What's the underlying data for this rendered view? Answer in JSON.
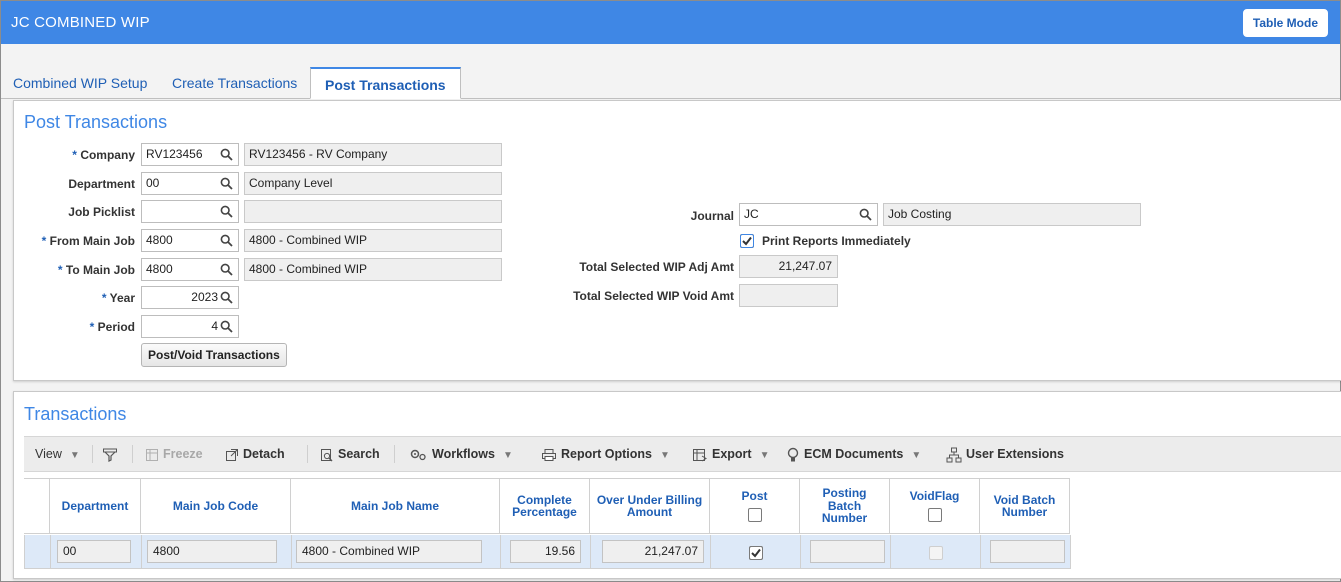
{
  "app": {
    "title": "JC COMBINED WIP",
    "table_mode_label": "Table Mode"
  },
  "tabs": [
    {
      "label": "Combined WIP Setup",
      "active": false
    },
    {
      "label": "Create Transactions",
      "active": false
    },
    {
      "label": "Post Transactions",
      "active": true
    }
  ],
  "post": {
    "title": "Post Transactions",
    "required_mark": "*",
    "company": {
      "label": "Company",
      "value": "RV123456",
      "desc": "RV123456 - RV Company"
    },
    "department": {
      "label": "Department",
      "value": "00",
      "desc": "Company Level"
    },
    "job_picklist": {
      "label": "Job Picklist",
      "value": "",
      "desc": ""
    },
    "from_main_job": {
      "label": "From Main Job",
      "value": "4800",
      "desc": "4800 - Combined WIP"
    },
    "to_main_job": {
      "label": "To Main Job",
      "value": "4800",
      "desc": "4800 - Combined WIP"
    },
    "year": {
      "label": "Year",
      "value": "2023"
    },
    "period": {
      "label": "Period",
      "value": "4"
    },
    "post_void_button": "Post/Void Transactions",
    "journal": {
      "label": "Journal",
      "value": "JC",
      "desc": "Job Costing"
    },
    "print_reports": {
      "label": "Print Reports Immediately",
      "checked": true
    },
    "total_adj": {
      "label": "Total Selected WIP Adj Amt",
      "value": "21,247.07"
    },
    "total_void": {
      "label": "Total Selected WIP Void Amt",
      "value": ""
    }
  },
  "transactions": {
    "title": "Transactions",
    "toolbar": {
      "view": "View",
      "freeze": "Freeze",
      "detach": "Detach",
      "search": "Search",
      "workflows": "Workflows",
      "report_options": "Report Options",
      "export": "Export",
      "ecm_documents": "ECM Documents",
      "user_extensions": "User Extensions"
    },
    "columns": {
      "department": "Department",
      "main_job_code": "Main Job Code",
      "main_job_name": "Main Job Name",
      "complete_pct_1": "Complete",
      "complete_pct_2": "Percentage",
      "over_under_1": "Over Under Billing",
      "over_under_2": "Amount",
      "post": "Post",
      "posting_batch_1": "Posting",
      "posting_batch_2": "Batch",
      "posting_batch_3": "Number",
      "void_flag": "VoidFlag",
      "void_batch_1": "Void Batch",
      "void_batch_2": "Number"
    },
    "rows": [
      {
        "department": "00",
        "main_job_code": "4800",
        "main_job_name": "4800 - Combined WIP",
        "complete_percentage": "19.56",
        "over_under_billing_amount": "21,247.07",
        "post": true,
        "posting_batch_number": "",
        "void_flag": false,
        "void_batch_number": ""
      }
    ]
  },
  "colors": {
    "accent": "#3f87e5",
    "link": "#1f5fb5",
    "row_selected": "#dde9f8"
  }
}
